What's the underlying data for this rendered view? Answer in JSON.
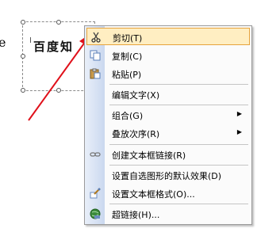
{
  "document": {
    "textbox_text": "百度知",
    "left_glyph": "e"
  },
  "menu": {
    "items": [
      {
        "label": "剪切(T)",
        "icon": "scissors-icon"
      },
      {
        "label": "复制(C)",
        "icon": "copy-icon"
      },
      {
        "label": "粘贴(P)",
        "icon": "paste-icon"
      },
      {
        "label": "编辑文字(X)",
        "icon": "none"
      },
      {
        "label": "组合(G)",
        "icon": "none"
      },
      {
        "label": "叠放次序(R)",
        "icon": "none"
      },
      {
        "label": "创建文本框链接(R)",
        "icon": "link-icon"
      },
      {
        "label": "设置自选图形的默认效果(D)",
        "icon": "none"
      },
      {
        "label": "设置文本框格式(O)...",
        "icon": "format-textbox-icon"
      },
      {
        "label": "超链接(H)...",
        "icon": "hyperlink-icon"
      }
    ]
  },
  "colors": {
    "highlight_bg": "#ffeec2",
    "highlight_border": "#e6a33c",
    "arrow": "#e0101a"
  }
}
